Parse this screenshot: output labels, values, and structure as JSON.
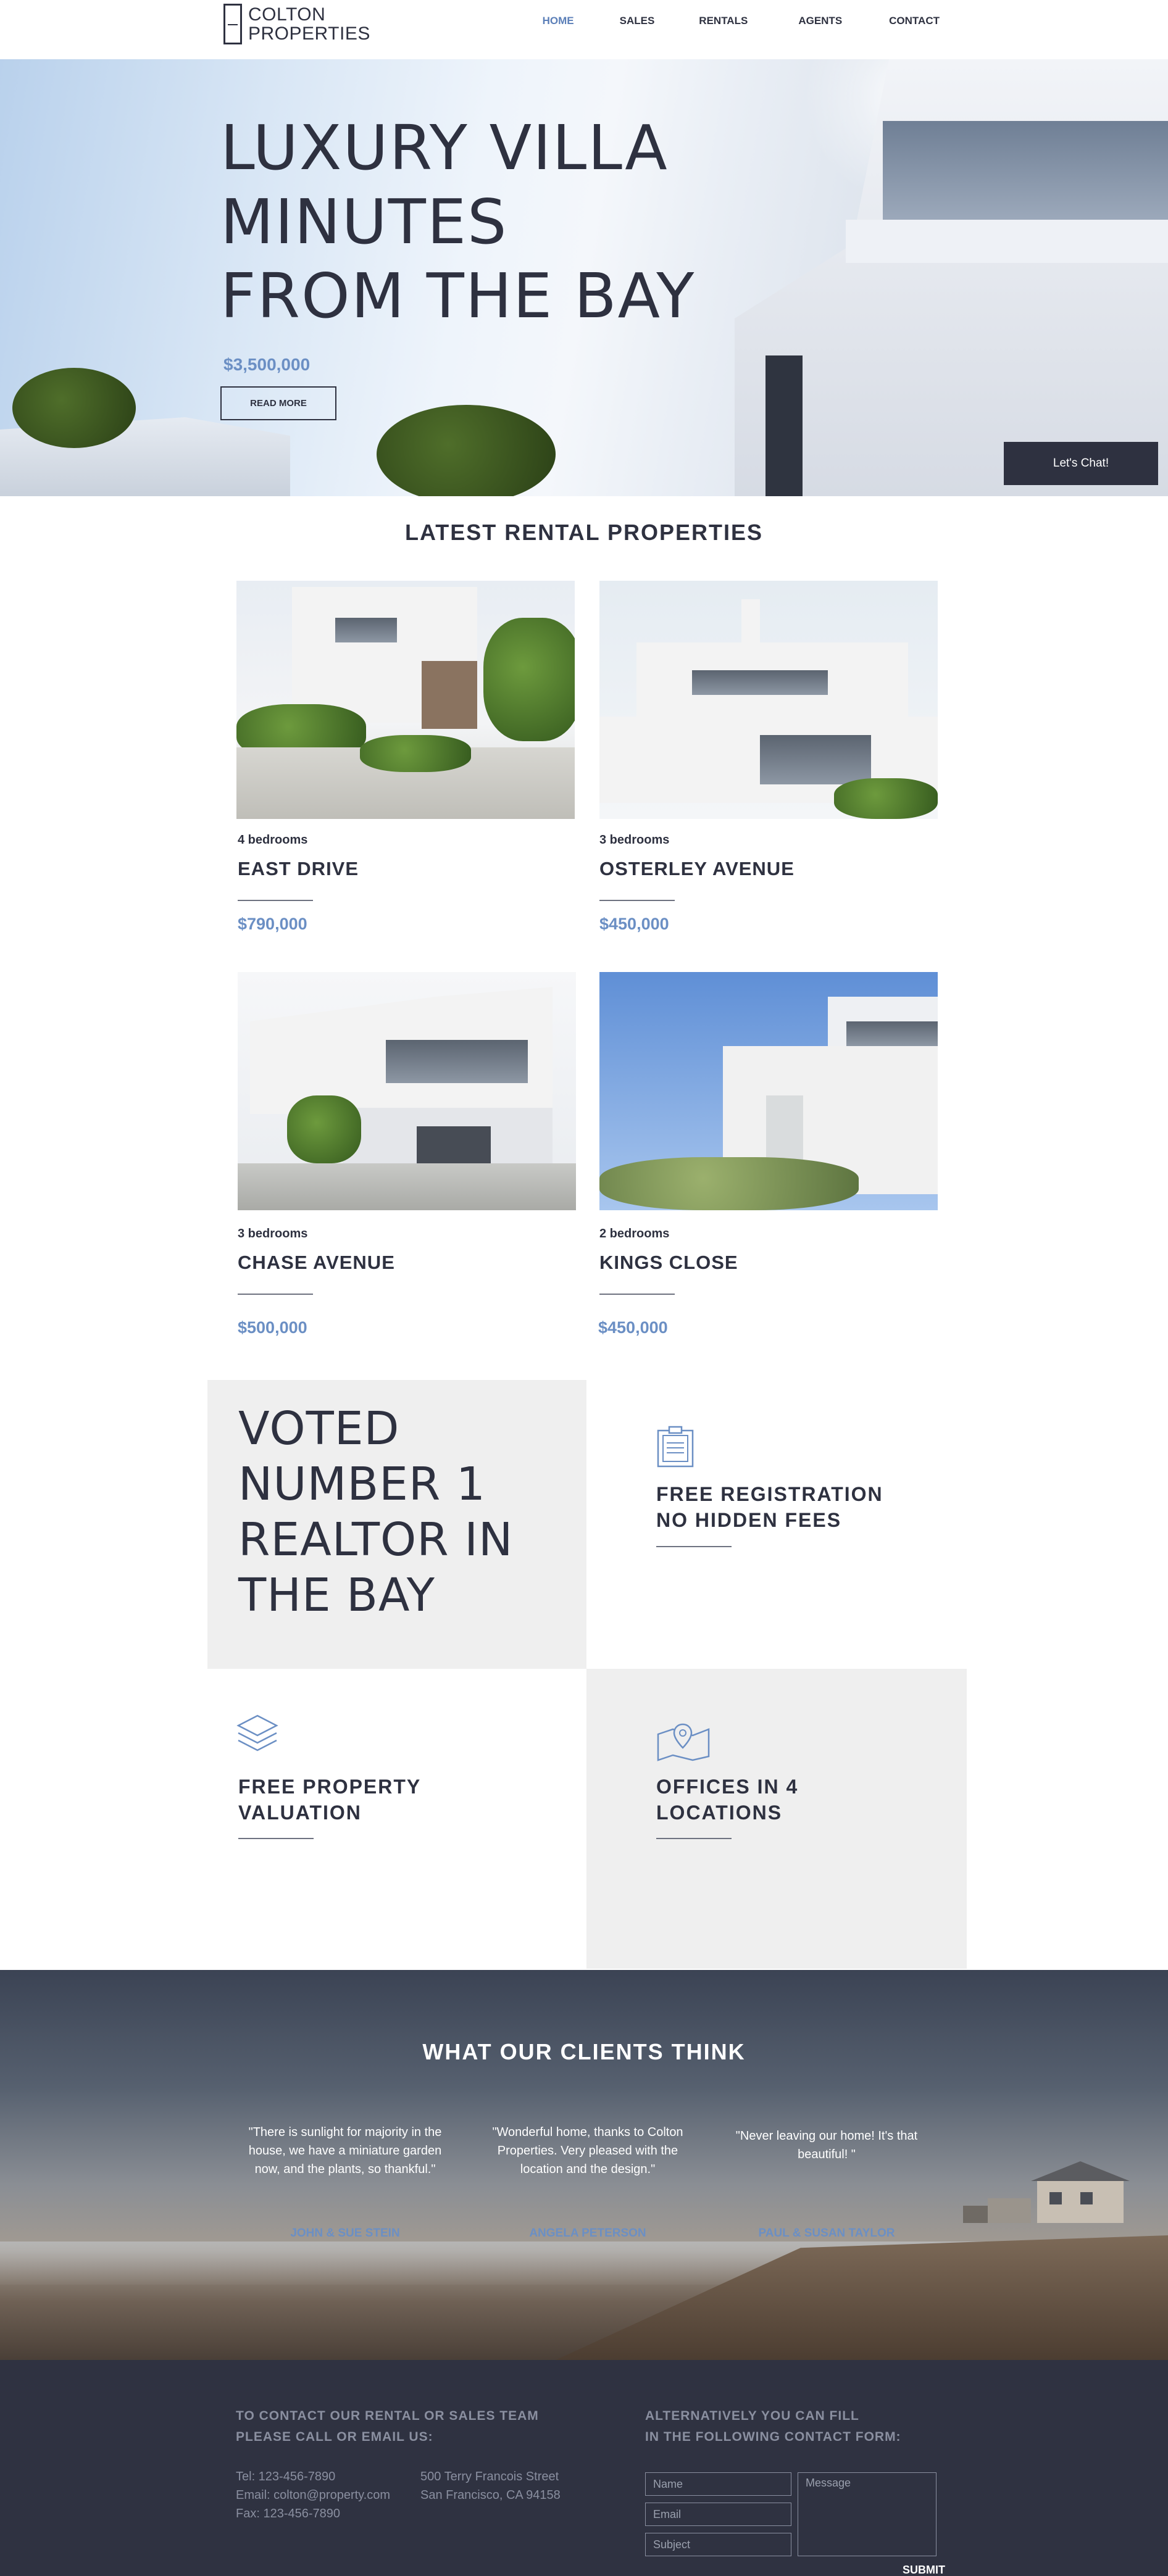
{
  "header": {
    "logo_line1": "COLTON",
    "logo_line2": "PROPERTIES",
    "nav": [
      "HOME",
      "SALES",
      "RENTALS",
      "AGENTS",
      "CONTACT"
    ],
    "active_nav": "HOME"
  },
  "hero": {
    "title_line1": "LUXURY VILLA",
    "title_line2": "MINUTES",
    "title_line3": "FROM THE BAY",
    "price": "$3,500,000",
    "button": "READ MORE",
    "chat": "Let's Chat!"
  },
  "rentals": {
    "title": "LATEST RENTAL PROPERTIES",
    "items": [
      {
        "bedrooms": "4 bedrooms",
        "name": "EAST DRIVE",
        "price": "$790,000"
      },
      {
        "bedrooms": "3 bedrooms",
        "name": "OSTERLEY AVENUE",
        "price": "$450,000"
      },
      {
        "bedrooms": "3 bedrooms",
        "name": "CHASE AVENUE",
        "price": "$500,000"
      },
      {
        "bedrooms": "2 bedrooms",
        "name": "KINGS CLOSE",
        "price": "$450,000"
      }
    ]
  },
  "features": {
    "voted": [
      "VOTED",
      "NUMBER 1",
      "REALTOR IN",
      "THE BAY"
    ],
    "items": [
      {
        "line1": "FREE REGISTRATION",
        "line2": "NO HIDDEN FEES",
        "icon": "clipboard-icon"
      },
      {
        "line1": "FREE PROPERTY",
        "line2": "VALUATION",
        "icon": "layers-icon"
      },
      {
        "line1": "OFFICES IN 4",
        "line2": "LOCATIONS",
        "icon": "map-pin-icon"
      }
    ]
  },
  "testimonials": {
    "title": "WHAT OUR CLIENTS THINK",
    "items": [
      {
        "quote": "\"There is sunlight for majority in the house, we have a miniature garden now, and the plants, so thankful.\"",
        "author": "JOHN & SUE STEIN"
      },
      {
        "quote": "\"Wonderful home, thanks to Colton Properties. Very pleased with the location and the design.\"",
        "author": "ANGELA PETERSON"
      },
      {
        "quote": "\"Never leaving our home! It's that beautiful! \"",
        "author": "PAUL & SUSAN TAYLOR"
      }
    ]
  },
  "footer": {
    "contact_heading1": "TO CONTACT OUR RENTAL OR SALES TEAM",
    "contact_heading2": "PLEASE CALL OR EMAIL US:",
    "tel": "Tel: 123-456-7890",
    "email": "Email: colton@property.com",
    "fax": "Fax: 123-456-7890",
    "address1": "500 Terry Francois Street",
    "address2": "San Francisco, CA 94158",
    "form_heading1": "ALTERNATIVELY YOU CAN FILL",
    "form_heading2": "IN THE FOLLOWING CONTACT FORM:",
    "placeholder_name": "Name",
    "placeholder_email": "Email",
    "placeholder_subject": "Subject",
    "placeholder_message": "Message",
    "submit": "SUBMIT"
  },
  "colors": {
    "accent": "#6b8fc4",
    "dark": "#2e3140",
    "footer_bg": "#2f3241",
    "panel": "#efefef"
  }
}
